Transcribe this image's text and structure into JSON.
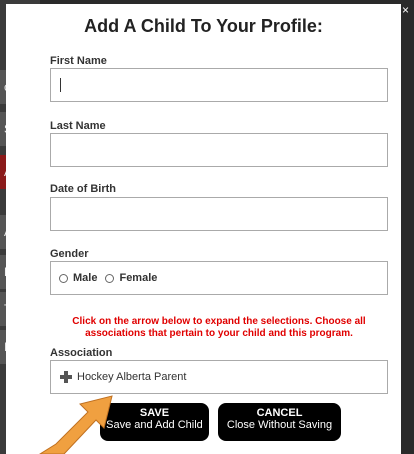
{
  "modal": {
    "title": "Add A Child To Your Profile:",
    "close_label": "×"
  },
  "form": {
    "first_name": {
      "label": "First Name",
      "value": ""
    },
    "last_name": {
      "label": "Last Name",
      "value": ""
    },
    "dob": {
      "label": "Date of Birth",
      "value": ""
    },
    "gender": {
      "label": "Gender",
      "options": [
        "Male",
        "Female"
      ]
    },
    "notice": "Click on the arrow below to expand the selections. Choose all associations that pertain to your child and this program.",
    "association": {
      "label": "Association",
      "item": "Hockey Alberta Parent"
    }
  },
  "buttons": {
    "save": {
      "main": "SAVE",
      "sub": "Save and Add Child"
    },
    "cancel": {
      "main": "CANCEL",
      "sub": "Close Without Saving"
    }
  },
  "colors": {
    "notice": "#e00000",
    "arrow": "#f0a040",
    "button_bg": "#000000"
  },
  "background_chips": [
    "c F",
    "S",
    "A",
    "A",
    "F",
    "Tl",
    "IR"
  ]
}
